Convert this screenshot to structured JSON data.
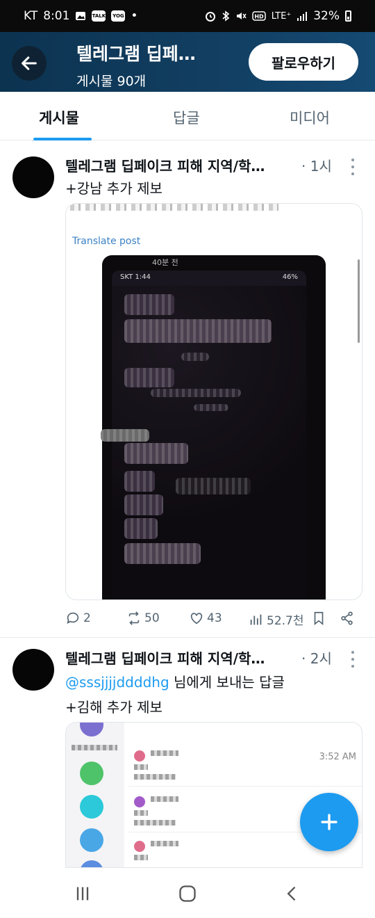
{
  "status_bar": {
    "carrier": "KT",
    "time": "8:01",
    "dot": "•",
    "network": "LTE⁺",
    "battery": "32%",
    "icons": [
      "gallery-icon",
      "talk-icon",
      "yogiyo-icon",
      "alarm-icon",
      "bluetooth-icon",
      "mute-icon",
      "hd-icon",
      "signal-icon",
      "battery-icon"
    ]
  },
  "header": {
    "title": "텔레그램 딥페…",
    "subtitle": "게시물 90개",
    "follow_label": "팔로우하기"
  },
  "tabs": [
    {
      "label": "게시물",
      "active": true
    },
    {
      "label": "답글",
      "active": false
    },
    {
      "label": "미디어",
      "active": false
    }
  ],
  "posts": [
    {
      "author": "텔레그램 딥페이크 피해 지역/학…",
      "time": "· 1시",
      "text": "+강남 추가 제보",
      "media_caption": "Translate post",
      "phone_header": "40분 전",
      "phone_status": "SKT 1:44",
      "phone_status_right": "46%",
      "stats": {
        "replies": "2",
        "retweets": "50",
        "likes": "43",
        "views": "52.7천"
      }
    },
    {
      "author": "텔레그램 딥페이크 피해 지역/학…",
      "time": "· 2시",
      "reply_to_handle": "@sssjjjjddddhg",
      "reply_to_suffix": " 님에게 보내는 답글",
      "text": "+김해 추가 제보",
      "media_time": "3:52 AM"
    }
  ],
  "colors": {
    "accent": "#1d9bf0",
    "header_bg": "#123f63",
    "text": "#0f1419",
    "muted": "#536471"
  }
}
